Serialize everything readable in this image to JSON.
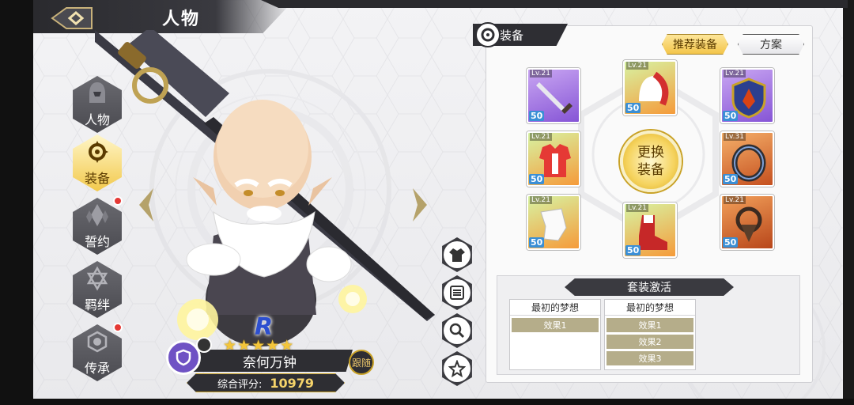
{
  "header": {
    "title": "人物"
  },
  "menu": [
    {
      "label": "人物",
      "icon": "hooded-figure-icon",
      "active": false,
      "badge": false
    },
    {
      "label": "装备",
      "icon": "equip-swirl-icon",
      "active": true,
      "badge": false
    },
    {
      "label": "誓约",
      "icon": "crystal-icon",
      "active": false,
      "badge": true
    },
    {
      "label": "羁绊",
      "icon": "star-link-icon",
      "active": false,
      "badge": false
    },
    {
      "label": "传承",
      "icon": "eye-emblem-icon",
      "active": false,
      "badge": true
    }
  ],
  "character": {
    "rank": "R",
    "stars": "★★★★★",
    "name": "奈何万钟",
    "follow_label": "跟随",
    "score_label": "综合评分:",
    "score_value": "10979"
  },
  "side_buttons": [
    "outfit-icon",
    "list-icon",
    "search-icon",
    "star-icon"
  ],
  "equipment": {
    "tab_label": "装备",
    "recommend_label": "推荐装备",
    "plan_label": "方案",
    "change_label_1": "更换",
    "change_label_2": "装备",
    "slots": [
      {
        "lv": "Lv.21",
        "stars": "50",
        "rarity": "purple",
        "item": "sword-icon"
      },
      {
        "lv": "Lv.21",
        "stars": "50",
        "rarity": "green",
        "item": "helmet-icon"
      },
      {
        "lv": "Lv.21",
        "stars": "50",
        "rarity": "purple",
        "item": "shield-icon"
      },
      {
        "lv": "Lv.21",
        "stars": "50",
        "rarity": "green",
        "item": "armor-icon"
      },
      {
        "lv": "Lv.31",
        "stars": "50",
        "rarity": "orange",
        "item": "ring-icon"
      },
      {
        "lv": "Lv.21",
        "stars": "50",
        "rarity": "green",
        "item": "gauntlet-icon"
      },
      {
        "lv": "Lv.21",
        "stars": "50",
        "rarity": "green",
        "item": "boots-icon"
      },
      {
        "lv": "Lv.21",
        "stars": "50",
        "rarity": "orange2",
        "item": "amulet-icon"
      }
    ]
  },
  "set_activation": {
    "title": "套装激活",
    "sets": [
      {
        "name": "最初的梦想",
        "effects": [
          {
            "label": "效果1",
            "on": true
          }
        ]
      },
      {
        "name": "最初的梦想",
        "effects": [
          {
            "label": "效果1",
            "on": true
          },
          {
            "label": "效果2",
            "on": true
          },
          {
            "label": "效果3",
            "on": true
          }
        ]
      }
    ]
  }
}
